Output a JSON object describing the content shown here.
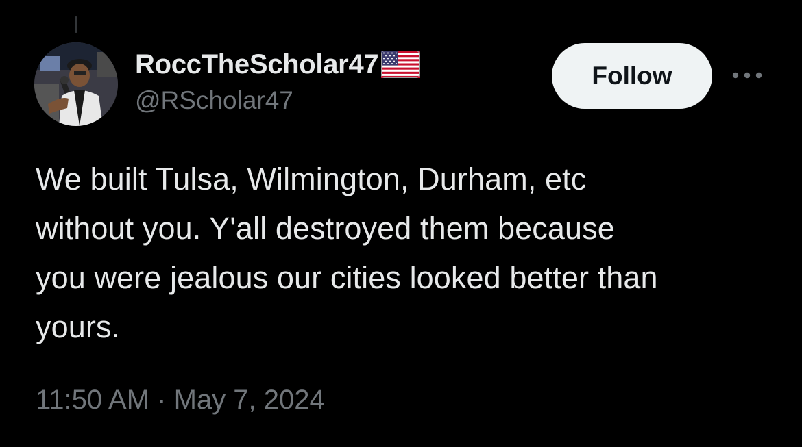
{
  "tweet": {
    "display_name": "RoccTheScholar47",
    "handle": "@RScholar47",
    "follow_label": "Follow",
    "text": "We built Tulsa, Wilmington, Durham, etc\nwithout you. Y'all destroyed them because\nyou were jealous our cities looked better than\nyours.",
    "time": "11:50 AM",
    "separator": " · ",
    "date": "May 7, 2024"
  },
  "icons": {
    "avatar": "profile-photo",
    "flag": "us-flag-emoji",
    "more": "more-horizontal-icon"
  },
  "colors": {
    "background": "#000000",
    "text_primary": "#e7e9ea",
    "text_secondary": "#71767b",
    "button_bg": "#eff3f4",
    "button_text": "#0f1419"
  }
}
